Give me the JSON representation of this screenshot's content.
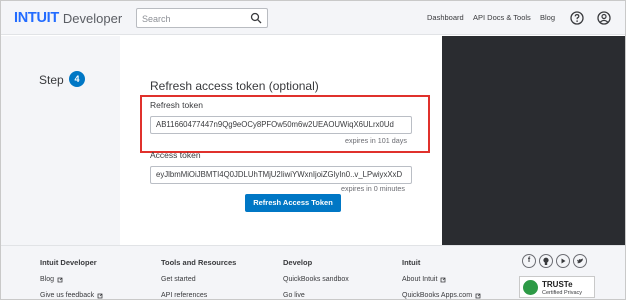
{
  "header": {
    "brand": "INTUIT",
    "product": "Developer",
    "search_placeholder": "Search",
    "nav": [
      "Dashboard",
      "API Docs & Tools",
      "Blog"
    ]
  },
  "step": {
    "label": "Step",
    "number": "4"
  },
  "section": {
    "title": "Refresh access token (optional)",
    "refresh_label": "Refresh token",
    "refresh_value": "AB11660477447n9Qg9eOCy8PFOw50m6w2UEAOUWiqX6ULrx0Ud",
    "refresh_expires": "expires in 101 days",
    "access_label": "Access token",
    "access_value": "eyJlbmMiOiJBMTI4Q0JDLUhTMjU2IiwiYWxnIjoiZGlyIn0..v_LPwiyxXxD",
    "access_expires": "expires in 0 minutes",
    "button_label": "Refresh Access Token"
  },
  "footer": {
    "columns": [
      {
        "heading": "Intuit Developer",
        "links": [
          "Blog",
          "Give us feedback"
        ]
      },
      {
        "heading": "Tools and Resources",
        "links": [
          "Get started",
          "API references"
        ]
      },
      {
        "heading": "Develop",
        "links": [
          "QuickBooks sandbox",
          "Go live"
        ]
      },
      {
        "heading": "Intuit",
        "links": [
          "About Intuit",
          "QuickBooks Apps.com"
        ]
      }
    ],
    "social": [
      "f",
      "gh",
      "yt",
      "tw"
    ],
    "truste_title": "TRUSTe",
    "truste_sub": "Certified Privacy"
  },
  "colors": {
    "accent": "#0077c5",
    "brand": "#236cff",
    "highlight": "#e0312c"
  }
}
